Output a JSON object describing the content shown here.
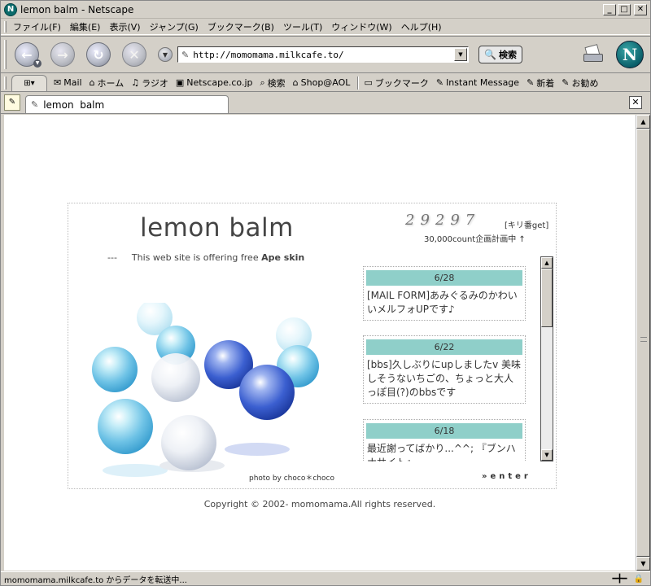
{
  "window": {
    "title": "lemon balm - Netscape",
    "app_icon": "N"
  },
  "menu": [
    "ファイル(F)",
    "編集(E)",
    "表示(V)",
    "ジャンプ(G)",
    "ブックマーク(B)",
    "ツール(T)",
    "ウィンドウ(W)",
    "ヘルプ(H)"
  ],
  "nav": {
    "url": "http://momomama.milkcafe.to/",
    "search_label": "検索"
  },
  "personal_toolbar": [
    {
      "icon": "mail-icon",
      "label": "Mail"
    },
    {
      "icon": "home-icon",
      "label": "ホーム"
    },
    {
      "icon": "radio-icon",
      "label": "ラジオ"
    },
    {
      "icon": "my-icon",
      "label": "Netscape.co.jp"
    },
    {
      "icon": "search-icon",
      "label": "検索"
    },
    {
      "icon": "shop-icon",
      "label": "Shop@AOL"
    },
    {
      "icon": "bookmark-icon",
      "label": "ブックマーク"
    },
    {
      "icon": "link-icon",
      "label": "Instant Message"
    },
    {
      "icon": "link-icon",
      "label": "新着"
    },
    {
      "icon": "link-icon",
      "label": "お勧め"
    }
  ],
  "tab": {
    "label": "lemon  balm"
  },
  "page": {
    "title": "lemon balm",
    "counter": "29297",
    "kiriban": "[キリ番get]",
    "plan": "30,000count企画計画中 ↑",
    "tagline_dash": "---",
    "tagline": "This web site is offering free",
    "tagline_skin": "Ape skin",
    "news": [
      {
        "date": "6/28",
        "text": "[MAIL FORM]あみぐるみのかわいいメルフォUPです♪"
      },
      {
        "date": "6/22",
        "text": "[bbs]久しぶりにupしましたv 美味しそうないちごの、ちょっと大人っぽ目(?)のbbsです"
      },
      {
        "date": "6/18",
        "text": "最近謝ってばかり...^^; 『ブンハナサイト』"
      }
    ],
    "photo_credit": "photo by choco＊choco",
    "enter": "»enter",
    "copyright": "Copyright © 2002- momomama.All rights reserved."
  },
  "status": {
    "text": "momomama.milkcafe.to からデータを転送中..."
  },
  "colors": {
    "date_bar": "#8fcfc9",
    "marble_blue": "#3b5fd0",
    "marble_cyan": "#7cc8e8"
  }
}
